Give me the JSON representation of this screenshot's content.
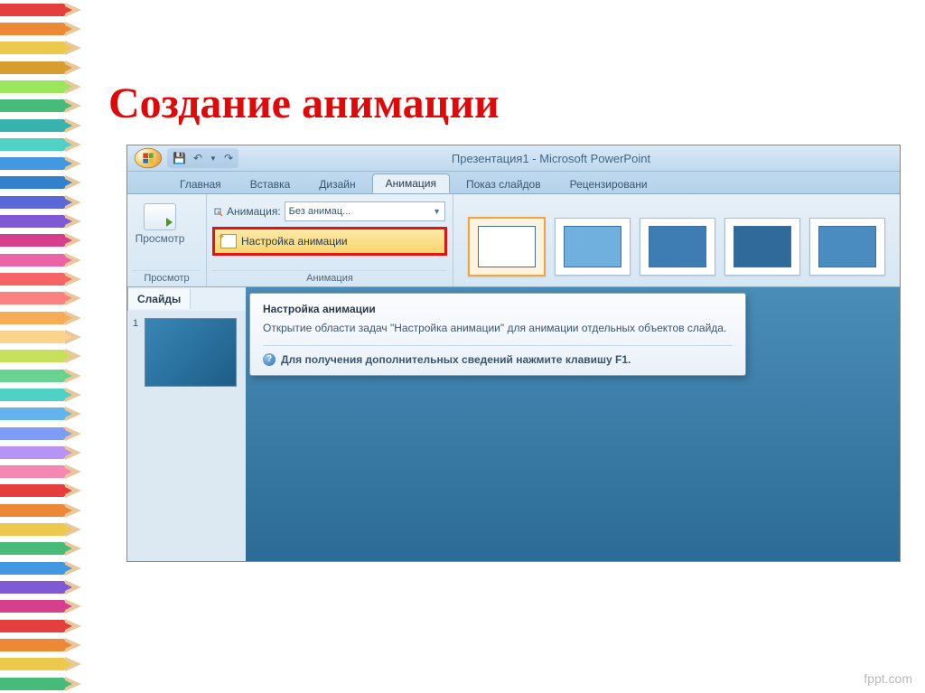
{
  "slide_title": "Создание анимации",
  "window_title": "Презентация1 - Microsoft PowerPoint",
  "qat": {
    "save": "💾",
    "undo": "↶",
    "redo": "↷"
  },
  "tabs": {
    "home": "Главная",
    "insert": "Вставка",
    "design": "Дизайн",
    "animation": "Анимация",
    "slideshow": "Показ слайдов",
    "review": "Рецензировани"
  },
  "ribbon": {
    "preview_group": {
      "button": "Просмотр",
      "label": "Просмотр"
    },
    "anim_group": {
      "row_label": "Анимация:",
      "dropdown_value": "Без анимац...",
      "custom_btn": "Настройка анимации",
      "group_label": "Анимация"
    }
  },
  "side_panel": {
    "tab_slides": "Слайды",
    "thumb_number": "1"
  },
  "tooltip": {
    "title": "Настройка анимации",
    "body": "Открытие области задач \"Настройка анимации\" для анимации отдельных объектов слайда.",
    "help": "Для получения дополнительных сведений нажмите клавишу F1."
  },
  "gallery_fills": [
    "#ffffff",
    "#6fb0de",
    "#3d7db3",
    "#2f6a9a",
    "#4a8cc0"
  ],
  "watermark": "fppt.com",
  "pencil_colors": [
    "#e53e3e",
    "#ed8936",
    "#ecc94b",
    "#d69e2e",
    "#9ae65c",
    "#48bb78",
    "#38b2ac",
    "#4fd1c5",
    "#4299e1",
    "#3182ce",
    "#5a67d8",
    "#805ad5",
    "#d53f8c",
    "#ed64a6",
    "#f56565",
    "#fc8181",
    "#f6ad55",
    "#fbd38d",
    "#c6e05c",
    "#68d391",
    "#4fd1c5",
    "#63b3ed",
    "#7f9cf5",
    "#b794f4",
    "#f687b3",
    "#e53e3e",
    "#ed8936",
    "#ecc94b",
    "#48bb78",
    "#4299e1",
    "#805ad5",
    "#d53f8c",
    "#e53e3e",
    "#ed8936",
    "#ecc94b",
    "#48bb78"
  ]
}
